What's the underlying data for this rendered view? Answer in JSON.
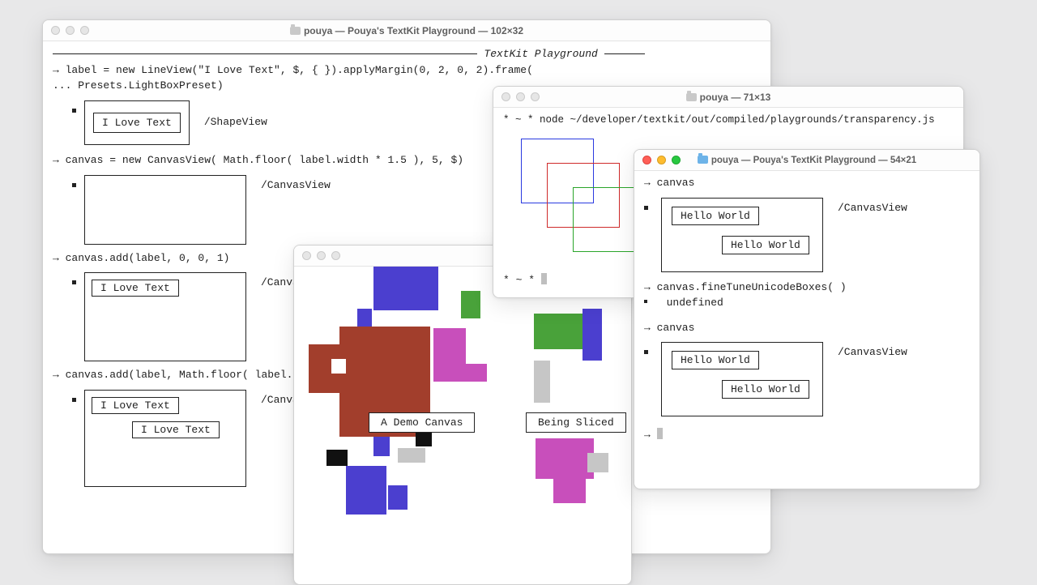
{
  "window1": {
    "title": "pouya — Pouya's TextKit Playground — 102×32",
    "banner": "TextKit Playground",
    "lines": {
      "l1": "→ label = new LineView(\"I Love Text\", $, { }).applyMargin(0, 2, 0, 2).frame(",
      "l1b": "... Presets.LightBoxPreset)",
      "tag_shape": "/ShapeView",
      "ilove": "I Love Text",
      "l2": "→ canvas = new CanvasView( Math.floor( label.width * 1.5 ), 5, $)",
      "tag_canvas": "/CanvasView",
      "l3": "→ canvas.add(label, 0, 0, 1)",
      "tag_canvas2": "/CanvasV",
      "l4": "→ canvas.add(label, Math.floor( label.",
      "tag_canvas3": "/CanvasV",
      "ilove2a": "I Love Text",
      "ilove2b": "I Love Text"
    }
  },
  "window_transparency": {
    "title": "pouya — 71×13",
    "cmd": "* ~ * node ~/developer/textkit/out/compiled/playgrounds/transparency.js",
    "prompt_end": "* ~ * "
  },
  "window_canvas": {
    "demo1": "A Demo Canvas",
    "demo2": "Being Sliced"
  },
  "window_hello": {
    "title": "pouya — Pouya's TextKit Playground — 54×21",
    "l1": "→ canvas",
    "tag": "/CanvasView",
    "hw": "Hello World",
    "l2": "→ canvas.fineTuneUnicodeBoxes( )",
    "und": "  undefined",
    "l3": "→ canvas",
    "lprompt": "→ "
  }
}
